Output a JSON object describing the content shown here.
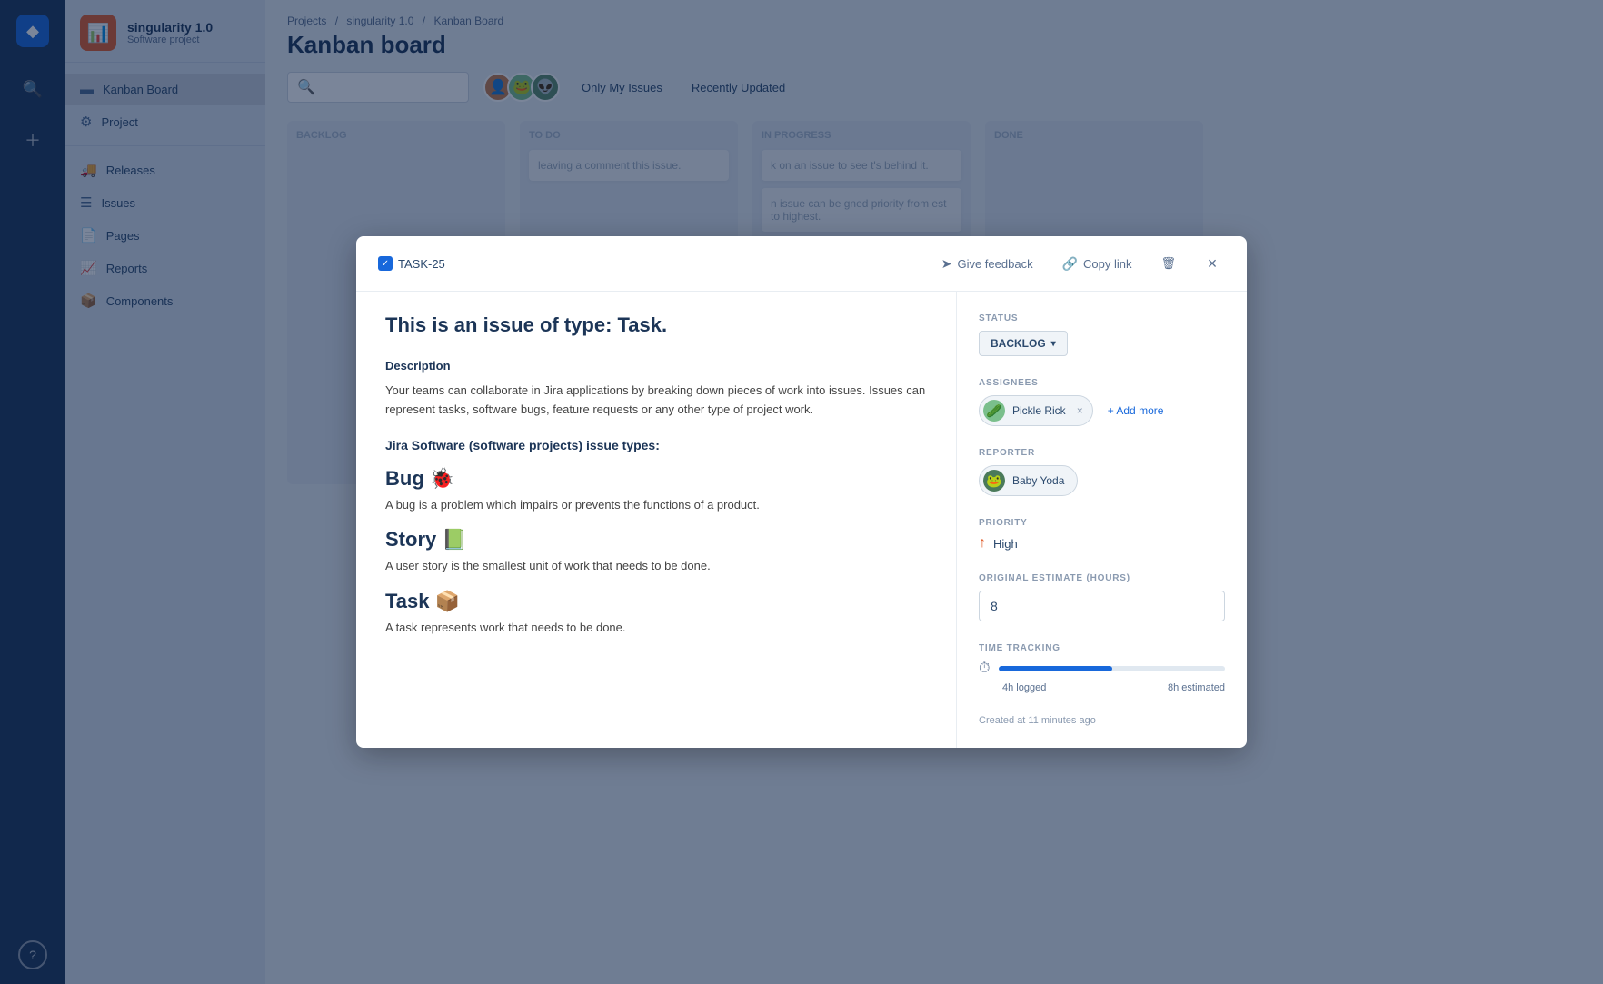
{
  "globalNav": {
    "logoIcon": "◆",
    "helpLabel": "?"
  },
  "projectSidebar": {
    "projectName": "singularity 1.0",
    "projectType": "Software project",
    "projectIconEmoji": "📊",
    "menuItems": [
      {
        "id": "kanban",
        "label": "Kanban Board",
        "icon": "▬",
        "active": true
      },
      {
        "id": "project",
        "label": "Project",
        "icon": "⚙"
      },
      {
        "id": "releases",
        "label": "Releases",
        "icon": "🚚"
      },
      {
        "id": "issues",
        "label": "Issues",
        "icon": "☰"
      },
      {
        "id": "pages",
        "label": "Pages",
        "icon": "📄"
      },
      {
        "id": "reports",
        "label": "Reports",
        "icon": "📈"
      },
      {
        "id": "components",
        "label": "Components",
        "icon": "📦"
      }
    ]
  },
  "header": {
    "breadcrumb": {
      "projects": "Projects",
      "sep1": "/",
      "projectName": "singularity 1.0",
      "sep2": "/",
      "currentPage": "Kanban Board"
    },
    "title": "Kanban board",
    "searchPlaceholder": "",
    "onlyMyIssues": "Only My Issues",
    "recentlyUpdated": "Recently Updated"
  },
  "modal": {
    "taskId": "TASK-25",
    "giveFeedbackLabel": "Give feedback",
    "copyLinkLabel": "Copy link",
    "closeLabel": "×",
    "issueTitle": "This is an issue of type: Task.",
    "descriptionLabel": "Description",
    "descriptionText": "Your teams can collaborate in Jira applications by breaking down pieces of work into issues. Issues can represent tasks, software bugs, feature requests or any other type of project work.",
    "issueTypesHeader": "Jira Software (software projects) issue types:",
    "issueTypes": [
      {
        "name": "Bug 🐞",
        "description": "A bug is a problem which impairs or prevents the functions of a product."
      },
      {
        "name": "Story 📗",
        "description": "A user story is the smallest unit of work that needs to be done."
      },
      {
        "name": "Task 📦",
        "description": "A task represents work that needs to be done."
      }
    ],
    "statusLabel": "STATUS",
    "statusValue": "BACKLOG",
    "assigneesLabel": "ASSIGNEES",
    "assigneeName": "Pickle Rick",
    "addMoreLabel": "+ Add more",
    "reporterLabel": "REPORTER",
    "reporterName": "Baby Yoda",
    "priorityLabel": "PRIORITY",
    "priorityValue": "High",
    "estimateLabel": "ORIGINAL ESTIMATE (HOURS)",
    "estimateValue": "8",
    "timeTrackingLabel": "TIME TRACKING",
    "timeLogged": "4h logged",
    "timeEstimated": "8h estimated",
    "timePercent": 50,
    "createdAt": "Created at 11 minutes ago"
  },
  "colors": {
    "brand": "#1c3557",
    "accent": "#1868db",
    "sidebarBg": "#d8e0eb",
    "navBg": "#1c3557",
    "statusBadgeBg": "#f0f4f8",
    "priorityHigh": "#e05c2a"
  }
}
